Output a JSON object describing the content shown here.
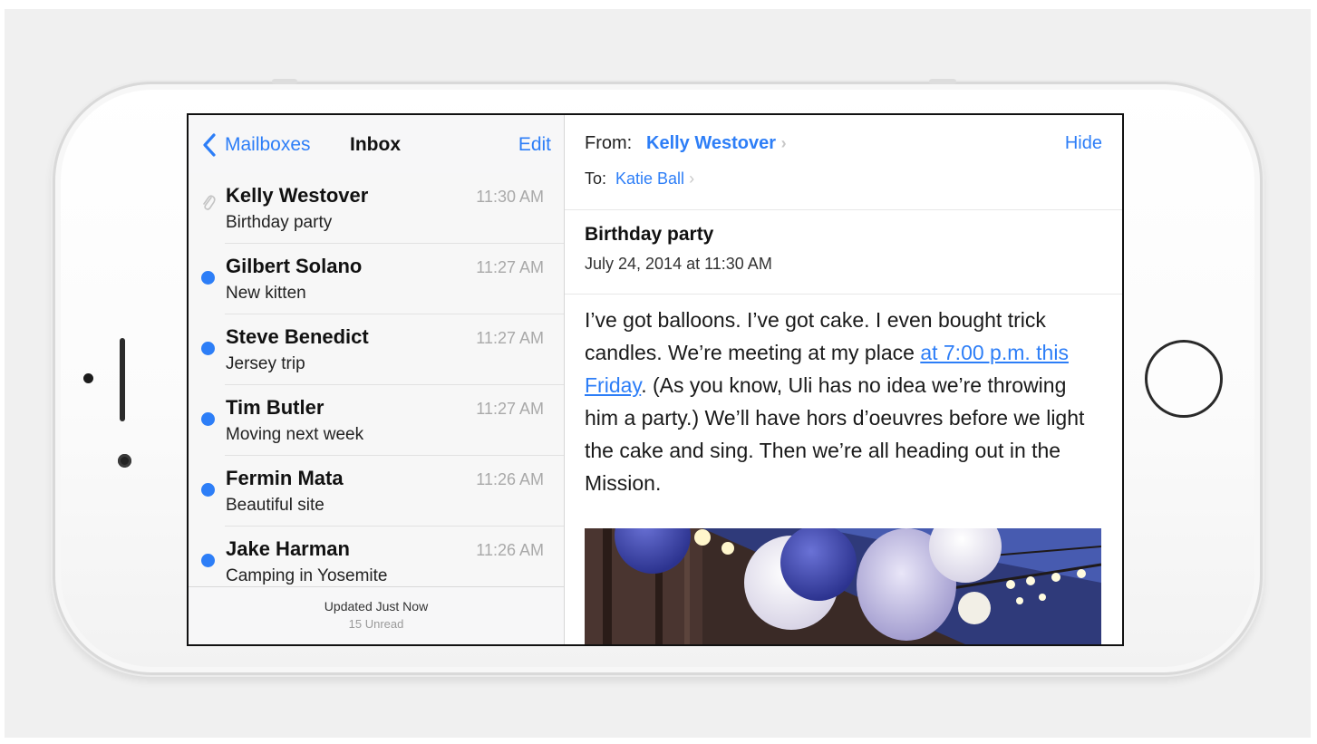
{
  "mailbox_nav": {
    "back_label": "Mailboxes",
    "title": "Inbox",
    "edit_label": "Edit"
  },
  "messages": [
    {
      "sender": "Kelly Westover",
      "subject": "Birthday party",
      "time": "11:30 AM",
      "unread": false,
      "attachment": true
    },
    {
      "sender": "Gilbert Solano",
      "subject": "New kitten",
      "time": "11:27 AM",
      "unread": true,
      "attachment": false
    },
    {
      "sender": "Steve Benedict",
      "subject": "Jersey trip",
      "time": "11:27 AM",
      "unread": true,
      "attachment": false
    },
    {
      "sender": "Tim Butler",
      "subject": "Moving next week",
      "time": "11:27 AM",
      "unread": true,
      "attachment": false
    },
    {
      "sender": "Fermin Mata",
      "subject": "Beautiful site",
      "time": "11:26 AM",
      "unread": true,
      "attachment": false
    },
    {
      "sender": "Jake Harman",
      "subject": "Camping in Yosemite",
      "time": "11:26 AM",
      "unread": true,
      "attachment": false
    }
  ],
  "list_footer": {
    "updated": "Updated Just Now",
    "unread": "15 Unread"
  },
  "detail": {
    "from_label": "From:",
    "from_name": "Kelly Westover",
    "to_label": "To:",
    "to_name": "Katie Ball",
    "hide_label": "Hide",
    "subject": "Birthday party",
    "date": "July 24, 2014 at 11:30 AM",
    "body_part1": "I’ve got balloons. I’ve got cake. I even bought trick candles. We’re meeting at my place ",
    "body_link": "at 7:00 p.m. this Friday",
    "body_part2": ". (As you know, Uli has no idea we’re throwing him a party.) We’ll have hors d’oeuvres before we light the cake and sing. Then we’re all heading out in the Mission."
  },
  "icons": {
    "back": "chevron-left-icon",
    "attachment": "paperclip-icon",
    "unread": "unread-dot-icon",
    "disclosure": "chevron-right-icon"
  },
  "colors": {
    "accent": "#2d7ef7",
    "time_gray": "#a9a9a9",
    "lantern_blue": "#3d46b0"
  }
}
